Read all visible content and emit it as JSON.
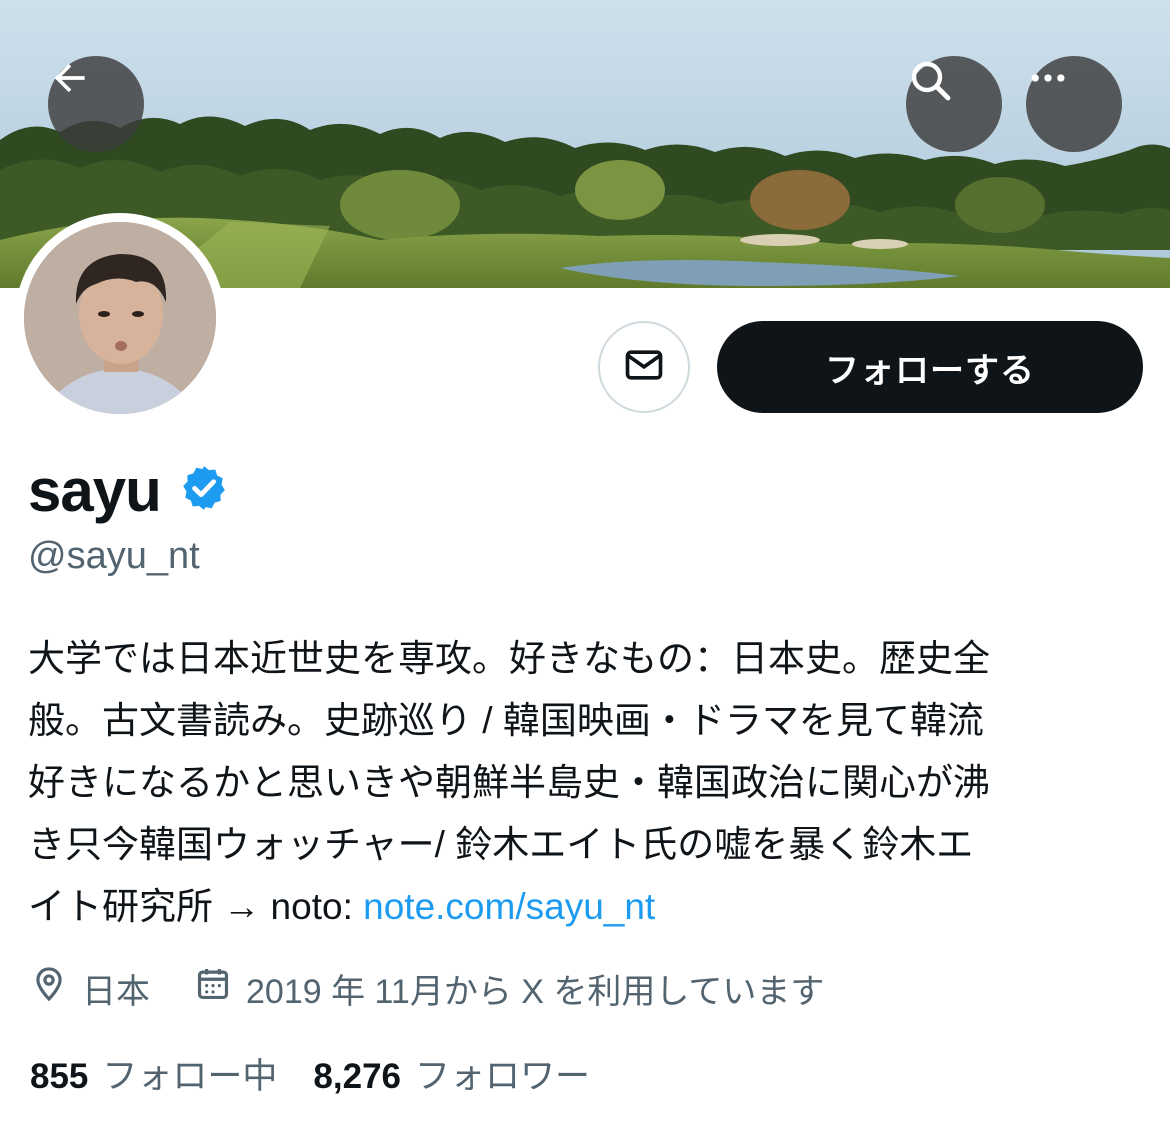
{
  "header": {
    "back_icon": "arrow-left-icon",
    "search_icon": "search-icon",
    "more_icon": "more-horizontal-icon",
    "banner_scene": "golf course landscape"
  },
  "profile": {
    "display_name": "sayu",
    "verified_icon": "verified-badge-icon",
    "verified_color": "#1d9bf0",
    "handle": "@sayu_nt",
    "bio_lines": [
      "大学では日本近世史を専攻。好きなもの：日本史。歴史全",
      "般。古文書読み。史跡巡り / 韓国映画・ドラマを見て韓流",
      "好きになるかと思いきや朝鮮半島史・韓国政治に関心が沸",
      "き只今韓国ウォッチャー/ 鈴木エイト氏の嘘を暴く鈴木エ"
    ],
    "bio_last_prefix": "イト研究所 → noto: ",
    "bio_link": "note.com/sayu_nt",
    "link_color": "#1d9bf0",
    "location": "日本",
    "location_icon": "location-pin-icon",
    "joined": "2019 年 11月から X を利用しています",
    "calendar_icon": "calendar-icon"
  },
  "actions": {
    "message_icon": "envelope-icon",
    "follow_label": "フォローする"
  },
  "stats": {
    "following_count": "855",
    "following_label": "フォロー中",
    "followers_count": "8,276",
    "followers_label": "フォロワー"
  }
}
